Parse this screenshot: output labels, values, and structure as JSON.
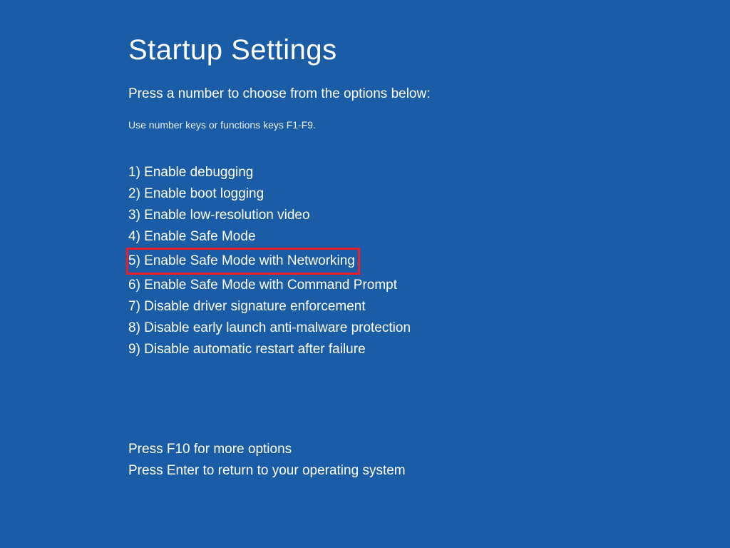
{
  "title": "Startup Settings",
  "instruction": "Press a number to choose from the options below:",
  "hint": "Use number keys or functions keys F1-F9.",
  "options": [
    "1) Enable debugging",
    "2) Enable boot logging",
    "3) Enable low-resolution video",
    "4) Enable Safe Mode",
    "5) Enable Safe Mode with Networking",
    "6) Enable Safe Mode with Command Prompt",
    "7) Disable driver signature enforcement",
    "8) Disable early launch anti-malware protection",
    "9) Disable automatic restart after failure"
  ],
  "highlighted_index": 4,
  "footer": {
    "line1": "Press F10 for more options",
    "line2": "Press Enter to return to your operating system"
  },
  "colors": {
    "background": "#1a5da6",
    "text": "#ffffff",
    "highlight_border": "#ee1c25"
  }
}
